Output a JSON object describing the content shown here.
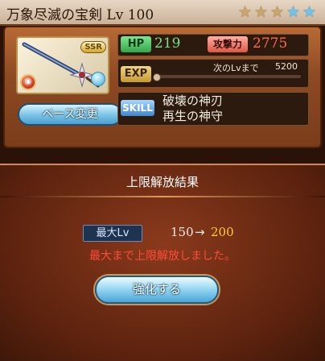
{
  "header": {
    "title": "万象尽滅の宝剣 Lv 100",
    "stars": [
      {
        "icon": "star-gold-icon",
        "glyph": "★",
        "color": "#c9a66b"
      },
      {
        "icon": "star-gold-icon",
        "glyph": "★",
        "color": "#c9a66b"
      },
      {
        "icon": "star-gold-icon",
        "glyph": "★",
        "color": "#c9a66b"
      },
      {
        "icon": "star-blue-icon",
        "glyph": "★",
        "color": "#6fc4ee"
      },
      {
        "icon": "star-blue-icon",
        "glyph": "★",
        "color": "#6fc4ee"
      }
    ]
  },
  "weapon": {
    "rarity": "SSR",
    "element_icon": "fire-element-icon",
    "skill_icon": "skill-orb-icon"
  },
  "stats": {
    "hp_label": "HP",
    "hp_value": "219",
    "atk_label": "攻撃力",
    "atk_value": "2775",
    "exp_label": "EXP",
    "next_lv_text": "次のLvまで",
    "next_lv_value": "5200",
    "exp_progress": 0,
    "skill_label": "SKILL",
    "skills": [
      "破壊の神刃",
      "再生の神守"
    ]
  },
  "buttons": {
    "base_change": "ベース変更",
    "enhance": "強化する"
  },
  "result": {
    "title": "上限解放結果",
    "max_lv_label": "最大Lv",
    "lv_from": "150",
    "arrow": "→",
    "lv_to": "200",
    "message": "最大まで上限解放しました。"
  },
  "colors": {
    "hp": "#76e08a",
    "atk": "#ff6a4a",
    "lv_to": "#ffcc33",
    "message": "#ff4b3a"
  }
}
